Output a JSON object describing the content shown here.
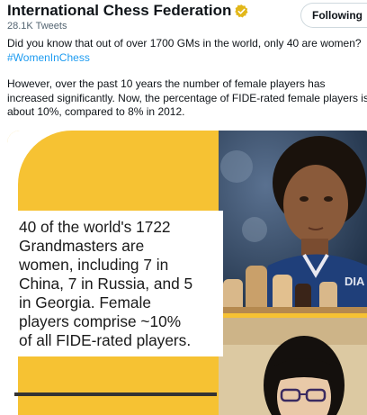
{
  "header": {
    "account_name": "International Chess Federation",
    "tweet_count": "28.1K Tweets",
    "follow_label": "Following"
  },
  "tweet": {
    "line1": "Did you know that out of over 1700 GMs in the world, only 40 are women?",
    "hashtag": "#WomenInChess",
    "para2_line1": "However, over the past 10 years the number of female players has",
    "para2_line2": "increased significantly. Now, the percentage of FIDE-rated female players is",
    "para2_line3": "about 10%, compared to 8% in 2012."
  },
  "media": {
    "card_text": "40 of the world's 1722\nGrandmasters are\nwomen, including 7 in\nChina, 7 in Russia, and 5\nin Georgia.  Female\nplayers comprise ~10%\nof all FIDE-rated players.",
    "shirt_text": "DIA"
  },
  "colors": {
    "accent_link": "#1d9bf0",
    "media_yellow": "#f6c233",
    "verified_gold": "#e2b719"
  },
  "icons": {
    "verified": "verified-badge-icon"
  }
}
